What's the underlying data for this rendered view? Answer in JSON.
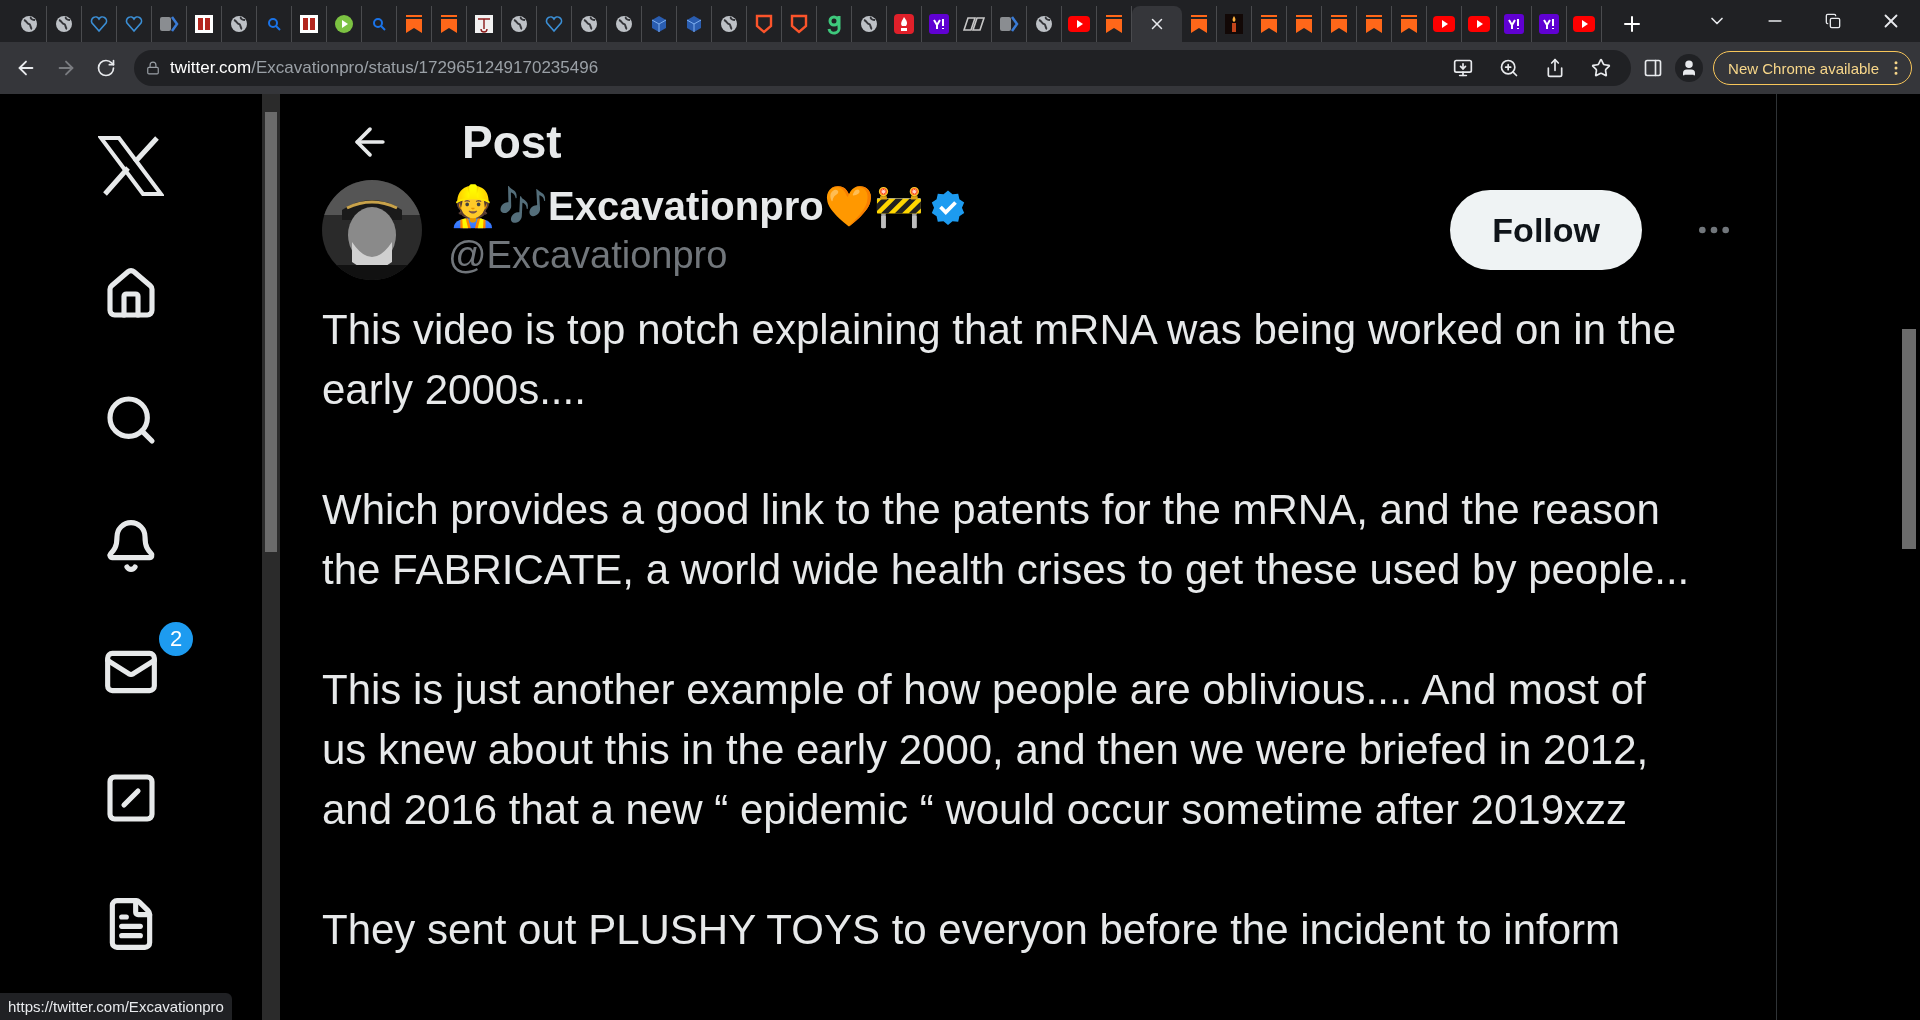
{
  "browser": {
    "tabs": [
      {
        "kind": "globe",
        "selected": false
      },
      {
        "kind": "globe",
        "selected": false
      },
      {
        "kind": "heart-shield",
        "selected": false
      },
      {
        "kind": "heart-shield",
        "selected": false
      },
      {
        "kind": "tag",
        "selected": false
      },
      {
        "kind": "red-white",
        "selected": false
      },
      {
        "kind": "globe",
        "selected": false
      },
      {
        "kind": "search",
        "selected": false
      },
      {
        "kind": "red-white",
        "selected": false
      },
      {
        "kind": "play",
        "selected": false
      },
      {
        "kind": "search",
        "selected": false
      },
      {
        "kind": "bookmark",
        "selected": false
      },
      {
        "kind": "bookmark",
        "selected": false
      },
      {
        "kind": "sketch",
        "selected": false
      },
      {
        "kind": "globe",
        "selected": false
      },
      {
        "kind": "heart-shield",
        "selected": false
      },
      {
        "kind": "globe",
        "selected": false
      },
      {
        "kind": "globe",
        "selected": false
      },
      {
        "kind": "cube",
        "selected": false
      },
      {
        "kind": "cube",
        "selected": false
      },
      {
        "kind": "globe",
        "selected": false
      },
      {
        "kind": "shield",
        "selected": false
      },
      {
        "kind": "shield",
        "selected": false
      },
      {
        "kind": "hook",
        "selected": false
      },
      {
        "kind": "globe",
        "selected": false
      },
      {
        "kind": "flame",
        "selected": false
      },
      {
        "kind": "purple",
        "selected": false
      },
      {
        "kind": "slant",
        "selected": false
      },
      {
        "kind": "tag",
        "selected": false
      },
      {
        "kind": "globe",
        "selected": false
      },
      {
        "kind": "video",
        "selected": false
      },
      {
        "kind": "bookmark",
        "selected": false
      },
      {
        "selected": true
      },
      {
        "kind": "bookmark",
        "selected": false
      },
      {
        "kind": "candle",
        "selected": false
      },
      {
        "kind": "bookmark",
        "selected": false
      },
      {
        "kind": "bookmark",
        "selected": false
      },
      {
        "kind": "bookmark",
        "selected": false
      },
      {
        "kind": "bookmark",
        "selected": false
      },
      {
        "kind": "bookmark",
        "selected": false
      },
      {
        "kind": "video",
        "selected": false
      },
      {
        "kind": "video",
        "selected": false
      },
      {
        "kind": "purple",
        "selected": false
      },
      {
        "kind": "purple",
        "selected": false
      },
      {
        "kind": "video",
        "selected": false
      }
    ],
    "forward_disabled": true,
    "address": {
      "host": "twitter.com",
      "path": "/Excavationpro/status/1729651249170235496"
    },
    "update_button": "New Chrome available"
  },
  "sidebar": {
    "items": [
      {
        "kind": "home"
      },
      {
        "kind": "search"
      },
      {
        "kind": "notifications"
      },
      {
        "kind": "messages",
        "badge": "2"
      },
      {
        "kind": "grok"
      },
      {
        "kind": "lists"
      }
    ]
  },
  "post": {
    "header": "Post",
    "author": {
      "name": "👷🎶Excavationpro🧡🚧",
      "handle": "@Excavationpro",
      "verified": true
    },
    "follow": "Follow",
    "paragraphs": [
      {
        "lines": [
          "This video is top notch explaining that mRNA was being worked on in the",
          "early 2000s...."
        ]
      },
      {
        "lines": [
          "Which provides a good link to the patents for the mRNA, and the reason",
          "the FABRICATE, a world wide health crises to get these used by people..."
        ]
      },
      {
        "lines": [
          "This is just another example of how people are oblivious.... And most of",
          "us knew about this in the early 2000, and then we were briefed in 2012,",
          "and 2016 that a new “ epidemic “ would occur sometime after 2019xzz"
        ]
      },
      {
        "lines": [
          "They sent out PLUSHY TOYS to everyon before the incident to inform"
        ]
      }
    ]
  },
  "status_url": "https://twitter.com/Excavationpro"
}
